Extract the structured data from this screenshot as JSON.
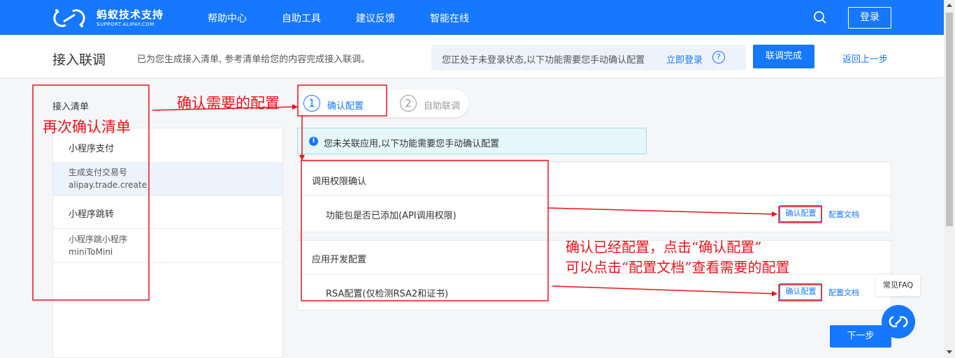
{
  "topbar": {
    "logo_cn": "蚂蚁技术支持",
    "logo_en": "SUPPORT.ALIPAY.COM",
    "nav": [
      "帮助中心",
      "自助工具",
      "建议反馈",
      "智能在线"
    ],
    "login": "登录",
    "icons": {
      "search": "search-icon",
      "logo": "alipay-logo-icon"
    }
  },
  "subheader": {
    "title": "接入联调",
    "description": "已为您生成接入清单, 参考清单给您的内容完成接入联调。",
    "notice": "您正处于未登录状态,以下功能需要您手动确认配置",
    "notice_link": "立即登录",
    "help": "?",
    "done_button": "联调完成",
    "back_link": "返回上一步"
  },
  "checklist": {
    "title": "接入清单",
    "groups": [
      {
        "label": "小程序支付",
        "items": [
          {
            "name": "生成支付交易号",
            "api": "alipay.trade.create",
            "active": true
          }
        ]
      },
      {
        "label": "小程序跳转",
        "items": [
          {
            "name": "小程序跳小程序",
            "api": "miniToMini",
            "active": false
          }
        ]
      }
    ]
  },
  "steps": [
    {
      "num": "1",
      "label": "确认配置",
      "active": true
    },
    {
      "num": "2",
      "label": "自助联调",
      "active": false
    }
  ],
  "info_banner": {
    "icon": "i",
    "text": "您未关联应用,以下功能需要您手动确认配置"
  },
  "cards": [
    {
      "title": "调用权限确认",
      "row_label": "功能包是否已添加(API调用权限)",
      "confirm": "确认配置",
      "doc": "配置文档"
    },
    {
      "title": "应用开发配置",
      "row_label": "RSA配置(仅检测RSA2和证书)",
      "confirm": "确认配置",
      "doc": "配置文档"
    }
  ],
  "next_button": "下一步",
  "faq": {
    "label": "常见FAQ",
    "icon": "support-chat-icon"
  },
  "annotations": {
    "a1": "确认需要的配置",
    "a2": "再次确认清单",
    "a3_line1": "确认已经配置，点击“确认配置”",
    "a3_line2": "可以点击“配置文档”查看需要的配置",
    "color": "#e8131b"
  },
  "colors": {
    "primary": "#1677ff",
    "annotation": "#e8131b"
  }
}
